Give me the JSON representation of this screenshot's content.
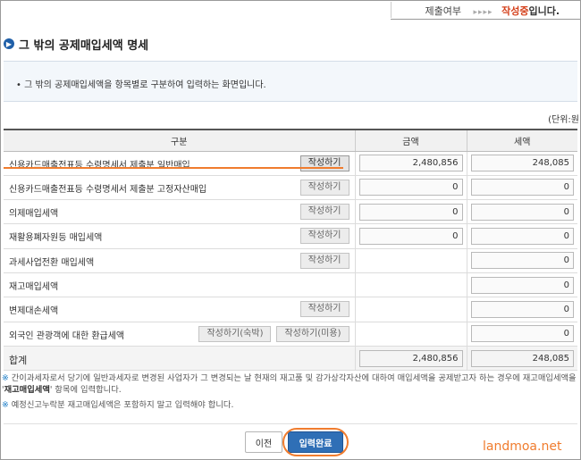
{
  "status_bar": {
    "label": "제출여부",
    "arrows": "▸▸▸▸",
    "current": "작성중",
    "suffix": "입니다."
  },
  "title": "그 밖의 공제매입세액 명세",
  "title_icon": "chevron-right-icon",
  "info_text": "• 그 밖의 공제매입세액을 항목별로 구분하여 입력하는 화면입니다.",
  "unit_text": "(단위:원",
  "table": {
    "headers": [
      "구분",
      "금액",
      "세액"
    ],
    "rows": [
      {
        "label": "신용카드매출전표등 수령명세서 제출분 일반매입",
        "buttons": [
          "작성하기"
        ],
        "amount": "2,480,856",
        "tax": "248,085"
      },
      {
        "label": "신용카드매출전표등 수령명세서 제출분 고정자산매입",
        "buttons": [
          "작성하기"
        ],
        "amount": "0",
        "tax": "0"
      },
      {
        "label": "의제매입세액",
        "buttons": [
          "작성하기"
        ],
        "amount": "0",
        "tax": "0"
      },
      {
        "label": "재활용폐자원등 매입세액",
        "buttons": [
          "작성하기"
        ],
        "amount": "0",
        "tax": "0"
      },
      {
        "label": "과세사업전환 매입세액",
        "buttons": [
          "작성하기"
        ],
        "amount": null,
        "tax": "0"
      },
      {
        "label": "재고매입세액",
        "buttons": [],
        "amount": null,
        "tax": "0"
      },
      {
        "label": "변제대손세액",
        "buttons": [
          "작성하기"
        ],
        "amount": null,
        "tax": "0"
      },
      {
        "label": "외국인 관광객에 대한 환급세액",
        "buttons": [
          "작성하기(숙박)",
          "작성하기(미용)"
        ],
        "amount": null,
        "tax": "0"
      }
    ],
    "total": {
      "label": "합계",
      "amount": "2,480,856",
      "tax": "248,085"
    }
  },
  "notes": {
    "note1_mark": "※",
    "note1_text": " 간이과세자로서 당기에 일반과세자로 변경된 사업자가 그 변경되는 날 현재의 재고품 및 감가상각자산에 대하여 매입세액을 공제받고자 하는 경우에 재고매입세액을 '",
    "note1_bold": "재고매입세액",
    "note1_tail": "' 항목에 입력합니다.",
    "note2_mark": "※",
    "note2_text": " 예정신고누락분 재고매입세액은 포함하지 말고 입력해야 합니다."
  },
  "buttons": {
    "prev": "이전",
    "done": "입력완료"
  },
  "watermark": "landmoa.net",
  "colors": {
    "accent_orange": "#f07c2e",
    "primary_blue": "#2f6fb6",
    "status_red": "#d43f1a"
  }
}
